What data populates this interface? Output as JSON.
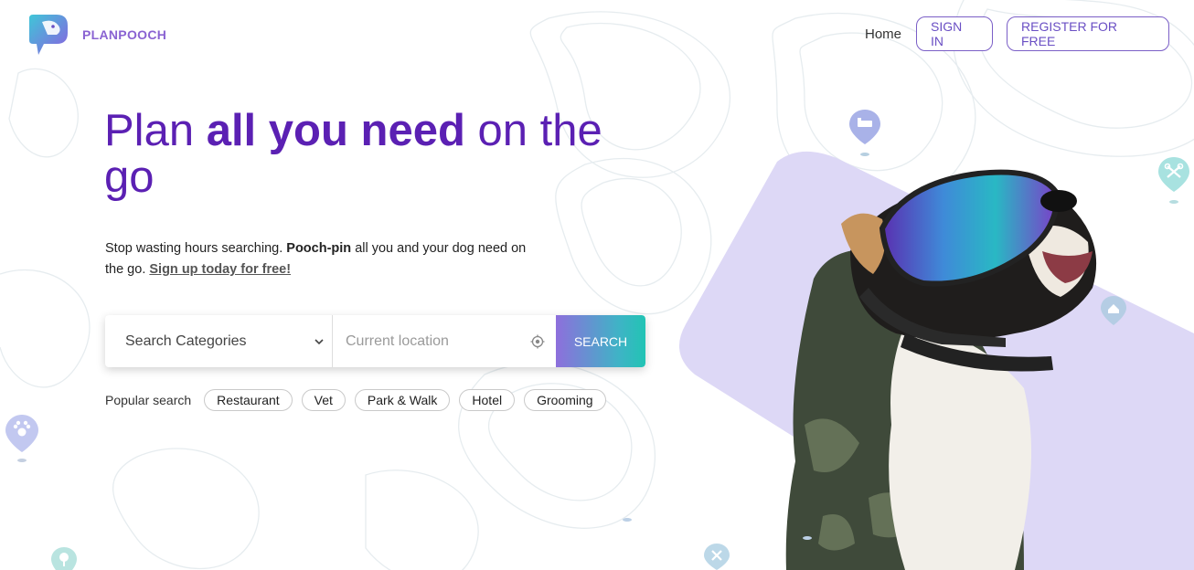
{
  "brand": {
    "name": "PLANPOOCH",
    "accent": "#8a63d2",
    "title_color": "#5b20b3"
  },
  "nav": {
    "home": "Home",
    "sign_in": "SIGN IN",
    "register": "REGISTER FOR FREE"
  },
  "hero": {
    "title_part1": "Plan ",
    "title_bold": "all you need",
    "title_part2": " on the go",
    "sub_part1": "Stop wasting hours searching. ",
    "sub_bold": "Pooch-pin",
    "sub_part2": " all you and your dog need on the go. ",
    "sub_link": "Sign up today for free!"
  },
  "search": {
    "category_value": "Search Categories",
    "location_placeholder": "Current location",
    "button": "SEARCH"
  },
  "popular": {
    "label": "Popular search",
    "chips": [
      "Restaurant",
      "Vet",
      "Park & Walk",
      "Hotel",
      "Grooming"
    ]
  },
  "icons": {
    "location": "crosshair-icon",
    "dropdown": "chevron-down-icon",
    "map_pins": [
      "bed-pin-icon",
      "scissors-pin-icon",
      "home-pin-icon",
      "paw-pin-icon",
      "tree-pin-icon",
      "vet-pin-icon"
    ]
  }
}
